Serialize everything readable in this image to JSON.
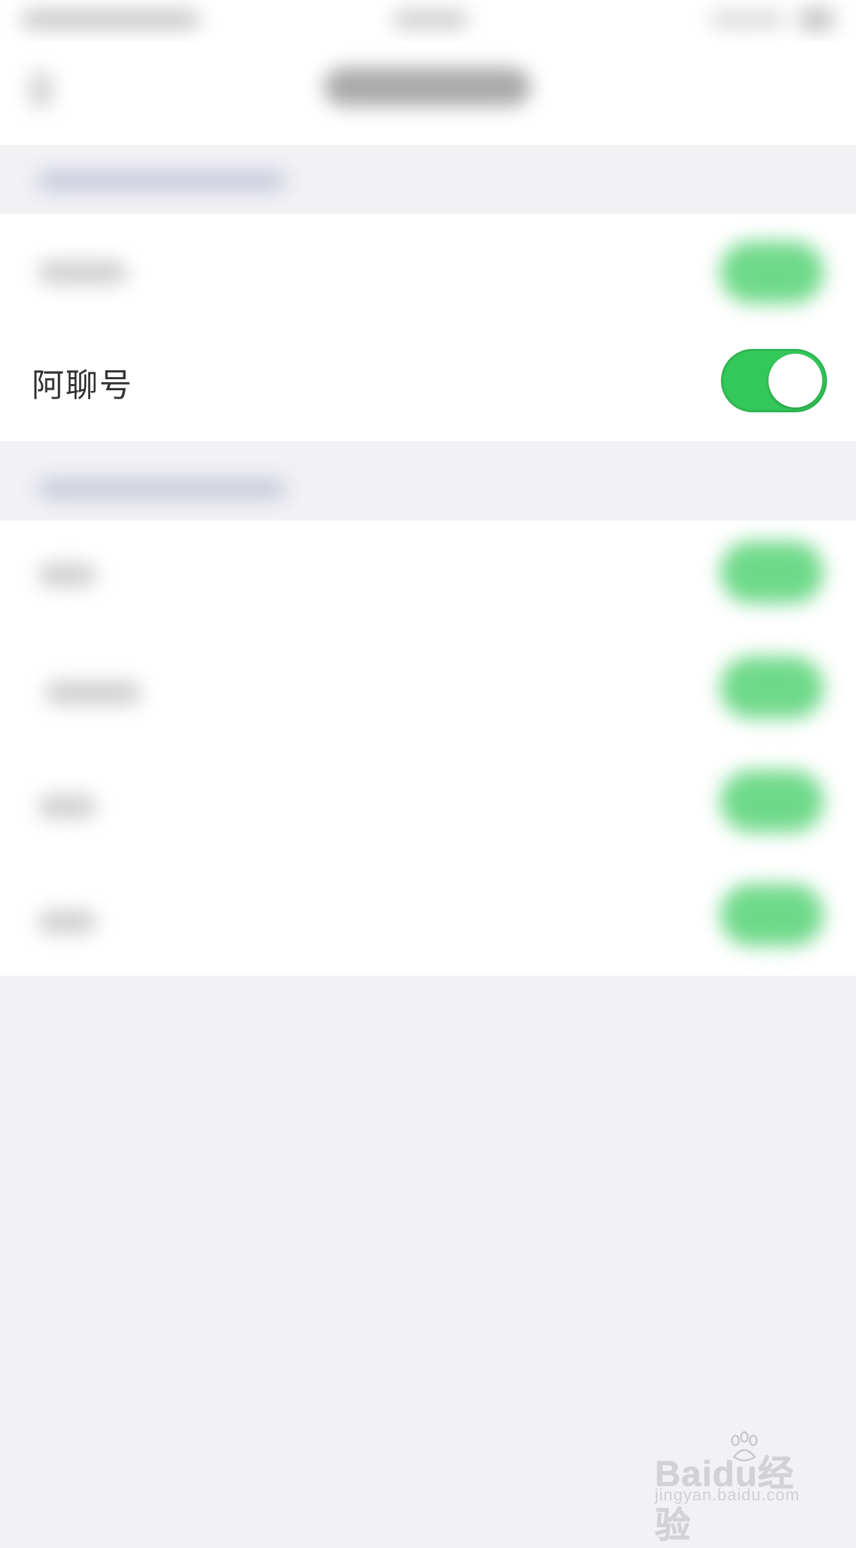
{
  "settings_rows": [
    {
      "label": "阿聊号",
      "toggle_on": true
    }
  ],
  "colors": {
    "toggle_on": "#34c759",
    "background": "#f2f2f5",
    "row_background": "#ffffff"
  },
  "icons": [
    "back-icon",
    "baidu-paw-icon"
  ],
  "watermark": {
    "logo": "Baidu经验",
    "url": "jingyan.baidu.com"
  }
}
